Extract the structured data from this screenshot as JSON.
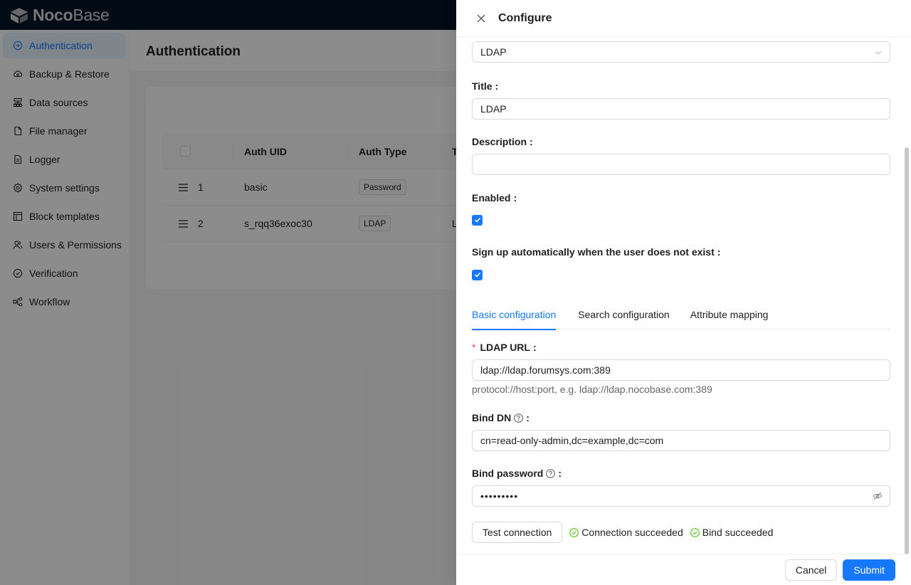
{
  "brand": {
    "strong": "Noco",
    "light": "Base"
  },
  "sidebar": {
    "items": [
      {
        "label": "Authentication",
        "icon": "login-icon"
      },
      {
        "label": "Backup & Restore",
        "icon": "cloud-icon"
      },
      {
        "label": "Data sources",
        "icon": "database-icon"
      },
      {
        "label": "File manager",
        "icon": "file-icon"
      },
      {
        "label": "Logger",
        "icon": "log-file-icon"
      },
      {
        "label": "System settings",
        "icon": "gear-icon"
      },
      {
        "label": "Block templates",
        "icon": "layout-icon"
      },
      {
        "label": "Users & Permissions",
        "icon": "users-icon"
      },
      {
        "label": "Verification",
        "icon": "check-circle-icon"
      },
      {
        "label": "Workflow",
        "icon": "workflow-icon"
      }
    ]
  },
  "page": {
    "title": "Authentication"
  },
  "table": {
    "columns": [
      "Auth UID",
      "Auth Type",
      "T"
    ],
    "rows": [
      {
        "index": "1",
        "uid": "basic",
        "type": "Password",
        "rest": ""
      },
      {
        "index": "2",
        "uid": "s_rqq36exoc30",
        "type": "LDAP",
        "rest": "L"
      }
    ]
  },
  "drawer": {
    "title": "Configure",
    "auth_type_value": "LDAP",
    "title_label": "Title",
    "title_value": "LDAP",
    "description_label": "Description",
    "description_value": "",
    "enabled_label": "Enabled",
    "signup_label": "Sign up automatically when the user does not exist",
    "tabs": [
      "Basic configuration",
      "Search configuration",
      "Attribute mapping"
    ],
    "ldap_url_label": "LDAP URL",
    "ldap_url_value": "ldap://ldap.forumsys.com:389",
    "ldap_url_help": "protocol://host:port, e.g. ldap://ldap.nocobase.com:389",
    "bind_dn_label": "Bind DN",
    "bind_dn_value": "cn=read-only-admin,dc=example,dc=com",
    "bind_password_label": "Bind password",
    "bind_password_value": "•••••••••",
    "test_button": "Test connection",
    "status_connection": "Connection succeeded",
    "status_bind": "Bind succeeded",
    "cancel_button": "Cancel",
    "submit_button": "Submit",
    "colon": ":"
  },
  "colors": {
    "primary": "#1677ff",
    "success": "#52c41a",
    "header": "#001529",
    "required": "#ff4d4f"
  }
}
